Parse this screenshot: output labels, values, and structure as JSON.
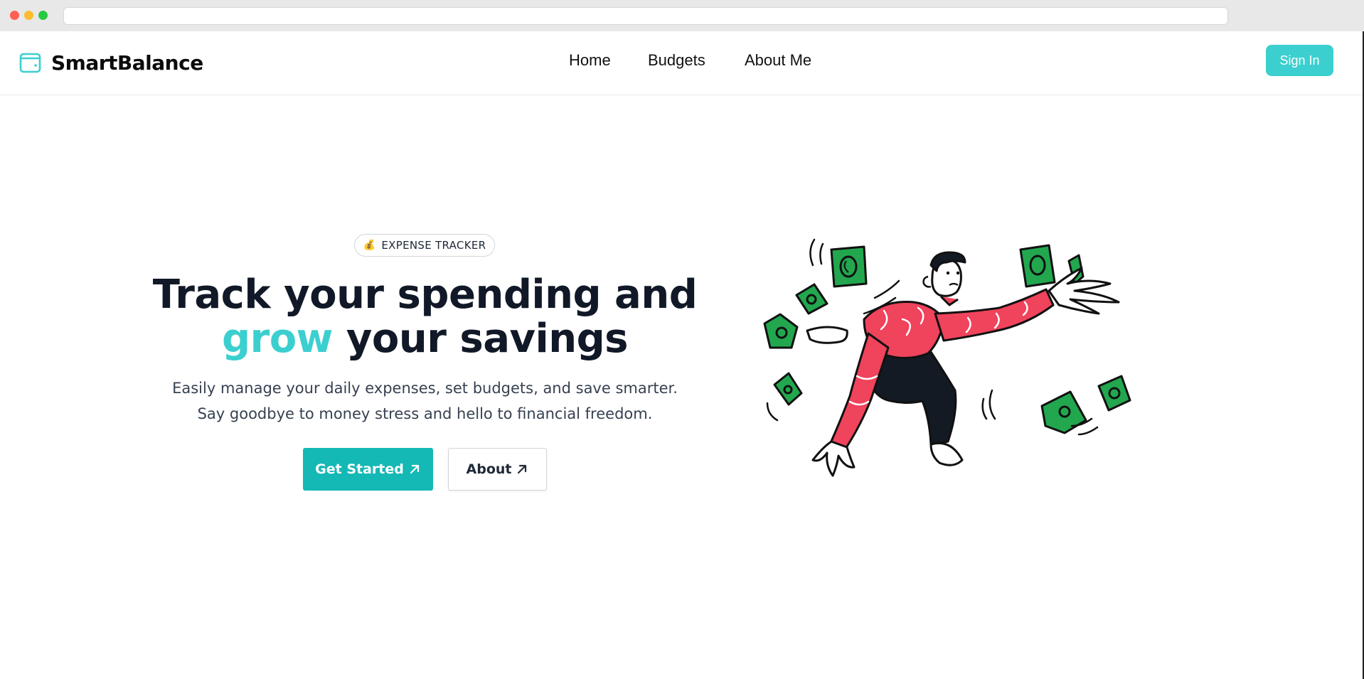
{
  "browser": {
    "url": ""
  },
  "navbar": {
    "brand": "SmartBalance",
    "brand_icon": "wallet-icon",
    "links": [
      "Home",
      "Budgets",
      "About Me"
    ],
    "signin_label": "Sign In"
  },
  "hero": {
    "badge_icon": "money-bag-icon",
    "badge_label": "EXPENSE TRACKER",
    "headline_line1": "Track your spending and",
    "headline_accent": "grow",
    "headline_line2_rest": " your savings",
    "subtitle": "Easily manage your daily expenses, set budgets, and save smarter. Say goodbye to money stress and hello to financial freedom.",
    "primary_button": "Get Started",
    "secondary_button": "About",
    "button_icon": "arrow-up-right-icon",
    "illustration": "person-throwing-money-illustration"
  },
  "colors": {
    "accent": "#3ccfcf",
    "primary_button": "#14b8b5",
    "shirt": "#f0435c",
    "money": "#1eaa4d",
    "text_dark": "#111827"
  }
}
